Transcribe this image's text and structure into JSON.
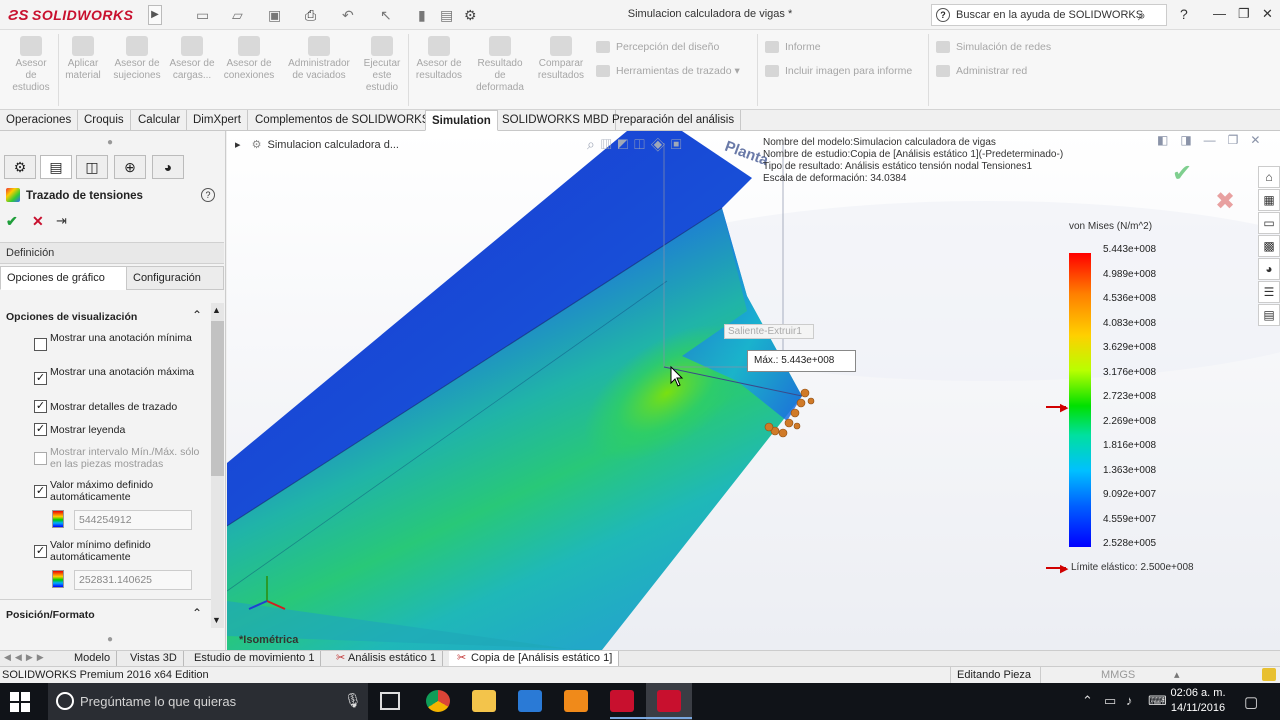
{
  "app": {
    "logo": "SOLIDWORKS",
    "doc_title": "Simulacion calculadora de vigas *",
    "help_search_placeholder": "Buscar en la ayuda de SOLIDWORKS",
    "help_glyph": "?",
    "window_controls": [
      "—",
      "❐",
      "✕"
    ]
  },
  "ribbon": {
    "buttons": [
      "Asesor de estudios",
      "Aplicar material",
      "Asesor de sujeciones",
      "Asesor de cargas...",
      "Asesor de conexiones",
      "Administrador de vaciados",
      "Ejecutar este estudio",
      "Asesor de resultados",
      "Resultado de deformada",
      "Comparar resultados"
    ],
    "rows": [
      "Percepción del diseño",
      "Herramientas de trazado",
      "Informe",
      "Incluir imagen para informe",
      "Simulación de redes",
      "Administrar red"
    ]
  },
  "command_tabs": [
    "Operaciones",
    "Croquis",
    "Calcular",
    "DimXpert",
    "Complementos de SOLIDWORKS",
    "Simulation",
    "SOLIDWORKS MBD",
    "Preparación del análisis"
  ],
  "active_command_tab": "Simulation",
  "property_manager": {
    "title": "Trazado de tensiones",
    "ok_glyph": "✔",
    "cancel_glyph": "✕",
    "pin_glyph": "⇥",
    "help_glyph": "?",
    "section_definition": "Definición",
    "subtabs": [
      "Opciones de gráfico",
      "Configuración"
    ],
    "section_display": "Opciones de visualización",
    "options": [
      {
        "label": "Mostrar una anotación mínima",
        "checked": false,
        "enabled": true
      },
      {
        "label": "Mostrar una anotación máxima",
        "checked": true,
        "enabled": true
      },
      {
        "label": "Mostrar detalles de trazado",
        "checked": true,
        "enabled": true
      },
      {
        "label": "Mostrar leyenda",
        "checked": true,
        "enabled": true
      },
      {
        "label": "Mostrar intervalo Mín./Máx. sólo en las piezas mostradas",
        "checked": false,
        "enabled": false
      },
      {
        "label": "Valor máximo definido automáticamente",
        "checked": true,
        "enabled": true
      },
      {
        "label": "Valor mínimo definido automáticamente",
        "checked": true,
        "enabled": true
      }
    ],
    "max_value": "544254912",
    "min_value": "252831.140625",
    "section_position": "Posición/Formato"
  },
  "viewport": {
    "tree_root": "Simulacion calculadora d...",
    "view_name": "*Isométrica",
    "plane_label": "Planta",
    "info_lines": [
      "Nombre del modelo:Simulacion calculadora de vigas",
      "Nombre de estudio:Copia de [Análisis estático 1](-Predeterminado-)",
      "Tipo de resultado: Análisis estático tensión nodal Tensiones1",
      "Escala de deformación: 34.0384"
    ],
    "extrude_tag": "Saliente-Extruir1",
    "max_annotation": "Máx.: 5.443e+008"
  },
  "legend": {
    "title": "von Mises (N/m^2)",
    "ticks": [
      "5.443e+008",
      "4.989e+008",
      "4.536e+008",
      "4.083e+008",
      "3.629e+008",
      "3.176e+008",
      "2.723e+008",
      "2.269e+008",
      "1.816e+008",
      "1.363e+008",
      "9.092e+007",
      "4.559e+007",
      "2.528e+005"
    ],
    "limit_label": "Límite elástico: 2.500e+008",
    "colors": {
      "max": "#ff0000",
      "min": "#0000ff",
      "limit_arrow": "#d00000"
    }
  },
  "bottom_tabs": [
    "Modelo",
    "Vistas 3D",
    "Estudio de movimiento 1",
    "Análisis estático 1",
    "Copia de [Análisis estático 1]"
  ],
  "active_bottom_tab": "Copia de [Análisis estático 1]",
  "status": {
    "edition": "SOLIDWORKS Premium 2016 x64 Edition",
    "mode": "Editando Pieza",
    "units": "MMGS"
  },
  "taskbar": {
    "search_placeholder": "Pregúntame lo que quieras",
    "time": "02:06 a. m.",
    "date": "14/11/2016"
  }
}
